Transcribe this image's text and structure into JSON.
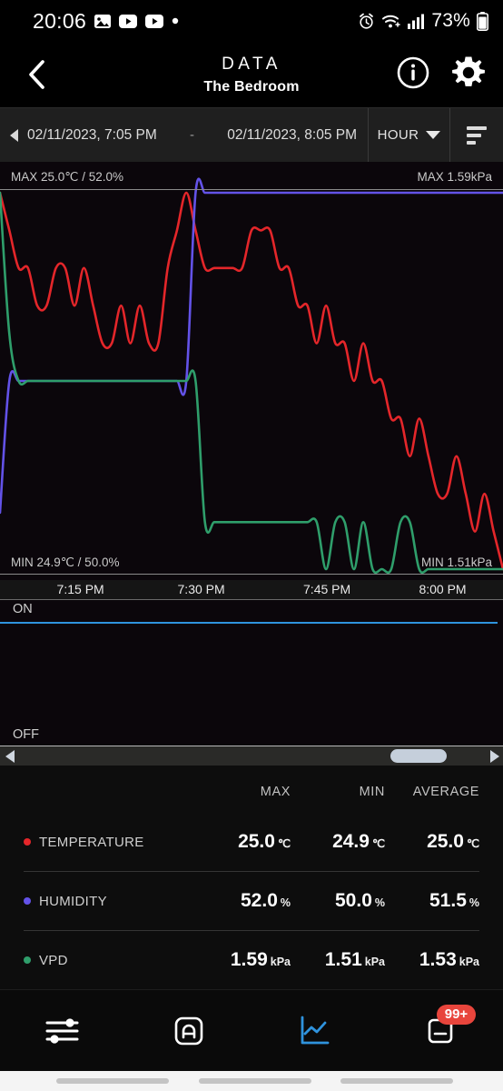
{
  "status_bar": {
    "time": "20:06",
    "battery_percent": "73%",
    "left_icons": [
      "photos-icon",
      "youtube-icon",
      "youtube-icon",
      "dot-icon"
    ],
    "right_icons": [
      "alarm-icon",
      "wifi-icon",
      "signal-icon",
      "battery-icon"
    ]
  },
  "header": {
    "back_icon": "chevron-left-icon",
    "title": "DATA",
    "subtitle": "The Bedroom",
    "info_icon": "info-icon",
    "settings_icon": "gear-icon"
  },
  "date_bar": {
    "prev_icon": "caret-left-icon",
    "start": "02/11/2023, 7:05 PM",
    "separator": "-",
    "end": "02/11/2023, 8:05 PM",
    "unit_label": "HOUR",
    "unit_caret_icon": "chevron-down-icon",
    "filter_icon": "filter-lines-icon"
  },
  "chart_labels": {
    "top_left": "MAX 25.0℃ / 52.0%",
    "top_right": "MAX 1.59kPa",
    "bottom_left": "MIN 24.9℃ / 50.0%",
    "bottom_right": "MIN 1.51kPa"
  },
  "onoff_panel": {
    "on_label": "ON",
    "off_label": "OFF",
    "line_color": "#2f93dd"
  },
  "scrollbar": {
    "left_arrow_icon": "caret-left-icon",
    "right_arrow_icon": "caret-right-icon",
    "thumb_position_percent": 88
  },
  "stats_table": {
    "columns": [
      "",
      "MAX",
      "MIN",
      "AVERAGE"
    ],
    "rows": [
      {
        "name": "TEMPERATURE",
        "color": "#e4262a",
        "unit": "℃",
        "max": "25.0",
        "min": "24.9",
        "average": "25.0"
      },
      {
        "name": "HUMIDITY",
        "color": "#6352e8",
        "unit": "%",
        "max": "52.0",
        "min": "50.0",
        "average": "51.5"
      },
      {
        "name": "VPD",
        "color": "#2f9e6b",
        "unit": "kPa",
        "max": "1.59",
        "min": "1.51",
        "average": "1.53"
      }
    ]
  },
  "bottom_nav": {
    "items": [
      {
        "icon": "sliders-icon",
        "active": false
      },
      {
        "icon": "auto-mode-icon",
        "active": false
      },
      {
        "icon": "chart-line-icon",
        "active": true
      },
      {
        "icon": "notes-icon",
        "active": false,
        "badge": "99+"
      }
    ],
    "active_color": "#2f93dd"
  },
  "chart_data": {
    "type": "line",
    "title": "",
    "xlabel": "",
    "ylabel": "",
    "grid": false,
    "legend_position": "bottom-table",
    "x_tick_labels": [
      "7:15 PM",
      "7:30 PM",
      "7:45 PM",
      "8:00 PM"
    ],
    "x_tick_positions_pct": [
      16,
      40,
      65,
      88
    ],
    "x_range": [
      "7:05 PM",
      "8:05 PM"
    ],
    "axis_annotations": {
      "left_top": "MAX 25.0℃ / 52.0%",
      "left_bottom": "MIN 24.9℃ / 50.0%",
      "right_top": "MAX 1.59kPa",
      "right_bottom": "MIN 1.51kPa"
    },
    "series": [
      {
        "name": "TEMPERATURE",
        "color": "#e4262a",
        "unit": "℃",
        "axis": "left",
        "ylim": [
          24.9,
          25.0
        ],
        "values": [
          25.0,
          24.99,
          24.98,
          24.98,
          24.97,
          24.97,
          24.98,
          24.98,
          24.97,
          24.98,
          24.97,
          24.96,
          24.96,
          24.97,
          24.96,
          24.97,
          24.96,
          24.96,
          24.98,
          24.99,
          25.0,
          24.99,
          24.98,
          24.98,
          24.98,
          24.98,
          24.98,
          24.99,
          24.99,
          24.99,
          24.98,
          24.98,
          24.97,
          24.97,
          24.96,
          24.97,
          24.96,
          24.96,
          24.95,
          24.96,
          24.95,
          24.95,
          24.94,
          24.94,
          24.93,
          24.94,
          24.93,
          24.92,
          24.92,
          24.93,
          24.92,
          24.91,
          24.92,
          24.91,
          24.9
        ]
      },
      {
        "name": "HUMIDITY",
        "color": "#6352e8",
        "unit": "%",
        "axis": "left",
        "ylim": [
          50.0,
          52.0
        ],
        "values": [
          50.3,
          51.0,
          51.0,
          51.0,
          51.0,
          51.0,
          51.0,
          51.0,
          51.0,
          51.0,
          51.0,
          51.0,
          51.0,
          51.0,
          51.0,
          51.0,
          51.0,
          51.0,
          51.0,
          51.0,
          51.0,
          52.0,
          52.0,
          52.0,
          52.0,
          52.0,
          52.0,
          52.0,
          52.0,
          52.0,
          52.0,
          52.0,
          52.0,
          52.0,
          52.0,
          52.0,
          52.0,
          52.0,
          52.0,
          52.0,
          52.0,
          52.0,
          52.0,
          52.0,
          52.0,
          52.0,
          52.0,
          52.0,
          52.0,
          52.0,
          52.0,
          52.0,
          52.0,
          52.0,
          52.0
        ]
      },
      {
        "name": "VPD",
        "color": "#2f9e6b",
        "unit": "kPa",
        "axis": "right",
        "ylim": [
          1.51,
          1.59
        ],
        "values": [
          1.59,
          1.56,
          1.55,
          1.55,
          1.55,
          1.55,
          1.55,
          1.55,
          1.55,
          1.55,
          1.55,
          1.55,
          1.55,
          1.55,
          1.55,
          1.55,
          1.55,
          1.55,
          1.55,
          1.55,
          1.55,
          1.55,
          1.52,
          1.52,
          1.52,
          1.52,
          1.52,
          1.52,
          1.52,
          1.52,
          1.52,
          1.52,
          1.52,
          1.52,
          1.52,
          1.51,
          1.52,
          1.52,
          1.51,
          1.52,
          1.51,
          1.51,
          1.51,
          1.52,
          1.52,
          1.51,
          1.51,
          1.51,
          1.51,
          1.51,
          1.51,
          1.51,
          1.51,
          1.51,
          1.51
        ]
      }
    ]
  }
}
